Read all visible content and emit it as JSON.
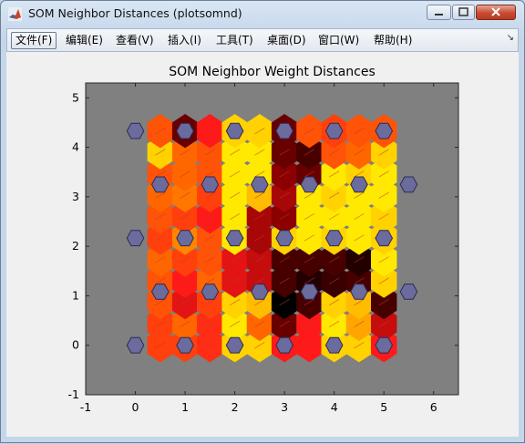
{
  "window": {
    "title": "SOM Neighbor Distances (plotsomnd)"
  },
  "menu": {
    "items": [
      "文件(F)",
      "编辑(E)",
      "查看(V)",
      "插入(I)",
      "工具(T)",
      "桌面(D)",
      "窗口(W)",
      "帮助(H)"
    ]
  },
  "chart_data": {
    "type": "heatmap",
    "title": "SOM Neighbor Weight Distances",
    "xlabel": "",
    "ylabel": "",
    "xlim": [
      -1,
      6.5
    ],
    "ylim": [
      -1,
      5.3
    ],
    "x_ticks": [
      "-1",
      "0",
      "1",
      "2",
      "3",
      "4",
      "5",
      "6"
    ],
    "y_ticks": [
      "-1",
      "0",
      "1",
      "2",
      "3",
      "4",
      "5"
    ],
    "grid": false,
    "background_color": "#808080",
    "neuron_color": "#6b6b9e",
    "colormap": [
      "#000000",
      "#8b0000",
      "#ff1a1a",
      "#ff6600",
      "#ffa500",
      "#ffff00"
    ],
    "neuron_grid": {
      "rows": 5,
      "cols": 6,
      "row_offset": 0.5
    },
    "distance_levels": {
      "x": [
        0.5,
        1.0,
        1.5,
        2.0,
        2.5,
        3.0,
        3.5,
        4.0,
        4.5,
        5.0
      ],
      "rows": [
        {
          "y": 0.0,
          "values": [
            0.5,
            0.5,
            0.45,
            0.9,
            0.9,
            0.4,
            0.4,
            0.9,
            0.9,
            0.4
          ]
        },
        {
          "y": 0.43,
          "values": [
            0.5,
            0.6,
            0.45,
            0.95,
            0.6,
            0.15,
            0.4,
            0.95,
            0.8,
            0.3
          ]
        },
        {
          "y": 0.87,
          "values": [
            0.55,
            0.35,
            0.5,
            0.9,
            0.85,
            0.0,
            0.1,
            0.9,
            0.85,
            0.1
          ]
        },
        {
          "y": 1.3,
          "values": [
            0.55,
            0.4,
            0.6,
            0.35,
            0.3,
            0.1,
            0.05,
            0.08,
            0.1,
            0.9
          ]
        },
        {
          "y": 1.73,
          "values": [
            0.6,
            0.5,
            0.55,
            0.35,
            0.3,
            0.1,
            0.1,
            0.1,
            0.05,
            0.95
          ]
        },
        {
          "y": 2.17,
          "values": [
            0.5,
            0.7,
            0.55,
            0.95,
            0.25,
            0.9,
            0.95,
            0.9,
            0.95,
            0.9
          ]
        },
        {
          "y": 2.6,
          "values": [
            0.55,
            0.5,
            0.4,
            0.95,
            0.25,
            0.2,
            0.95,
            0.95,
            0.95,
            0.9
          ]
        },
        {
          "y": 3.03,
          "values": [
            0.6,
            0.65,
            0.5,
            0.95,
            0.85,
            0.25,
            0.95,
            0.9,
            0.95,
            0.95
          ]
        },
        {
          "y": 3.46,
          "values": [
            0.55,
            0.6,
            0.55,
            0.95,
            0.95,
            0.2,
            0.15,
            0.95,
            0.9,
            0.95
          ]
        },
        {
          "y": 3.9,
          "values": [
            0.9,
            0.6,
            0.55,
            0.95,
            0.95,
            0.15,
            0.1,
            0.55,
            0.6,
            0.9
          ]
        },
        {
          "y": 4.33,
          "values": [
            0.55,
            0.15,
            0.4,
            0.9,
            0.9,
            0.15,
            0.55,
            0.5,
            0.55,
            0.55
          ]
        }
      ]
    }
  }
}
